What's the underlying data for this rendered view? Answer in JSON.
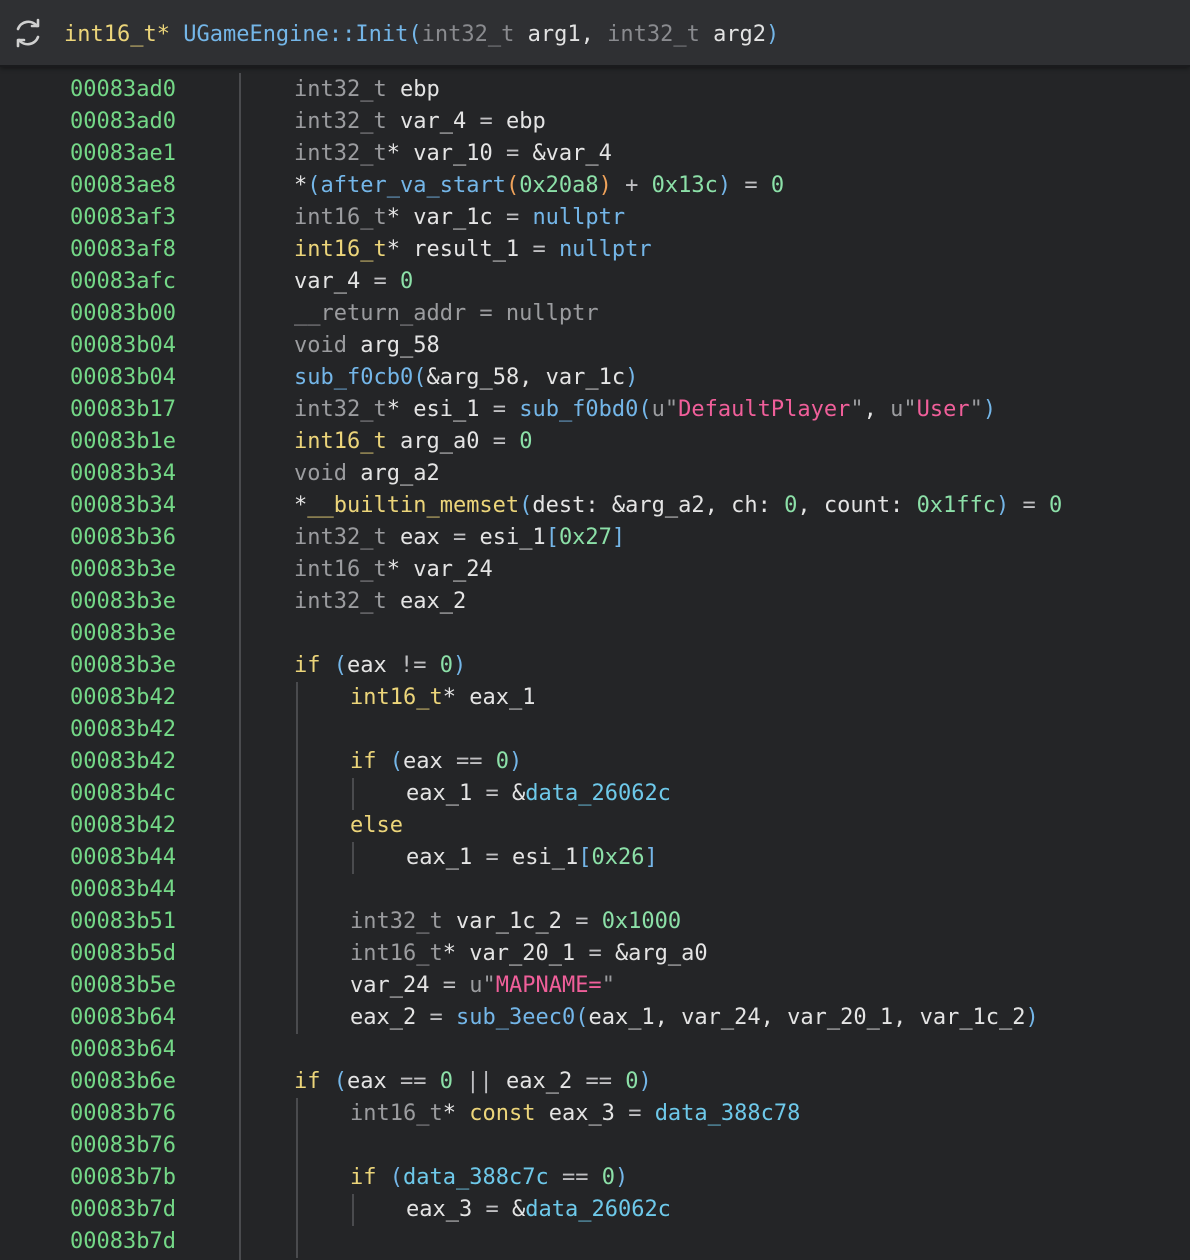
{
  "header": {
    "return_type": "int16_t*",
    "function_name": "UGameEngine::Init",
    "open_paren": "(",
    "param1_type": "int32_t",
    "param1_name": "arg1",
    "comma": ",",
    "param2_type": "int32_t",
    "param2_name": "arg2",
    "close_paren": ")"
  },
  "lines": [
    {
      "addr": "00083ad0",
      "tokens": [
        [
          "int32_t ",
          "type"
        ],
        [
          "ebp",
          "var"
        ]
      ]
    },
    {
      "addr": "00083ad0",
      "tokens": [
        [
          "int32_t ",
          "type"
        ],
        [
          "var_4 ",
          "var"
        ],
        [
          "= ",
          "op"
        ],
        [
          "ebp",
          "var"
        ]
      ]
    },
    {
      "addr": "00083ae1",
      "tokens": [
        [
          "int32_t",
          "type"
        ],
        [
          "* ",
          "var"
        ],
        [
          "var_10 ",
          "var"
        ],
        [
          "= ",
          "op"
        ],
        [
          "&var_4",
          "var"
        ]
      ]
    },
    {
      "addr": "00083ae8",
      "tokens": [
        [
          "*",
          "var"
        ],
        [
          "(",
          "paren"
        ],
        [
          "after_va_start",
          "fn"
        ],
        [
          "(",
          "orange"
        ],
        [
          "0x20a8",
          "hex"
        ],
        [
          ")",
          "orange"
        ],
        [
          " + ",
          "op"
        ],
        [
          "0x13c",
          "hex"
        ],
        [
          ")",
          "paren"
        ],
        [
          " = ",
          "op"
        ],
        [
          "0",
          "num"
        ]
      ]
    },
    {
      "addr": "00083af3",
      "tokens": [
        [
          "int16_t",
          "type"
        ],
        [
          "* ",
          "var"
        ],
        [
          "var_1c ",
          "var"
        ],
        [
          "= ",
          "op"
        ],
        [
          "nullptr",
          "fn"
        ]
      ]
    },
    {
      "addr": "00083af8",
      "tokens": [
        [
          "int16_t",
          "type-hi"
        ],
        [
          "* ",
          "var"
        ],
        [
          "result_1 ",
          "var"
        ],
        [
          "= ",
          "op"
        ],
        [
          "nullptr",
          "fn"
        ]
      ]
    },
    {
      "addr": "00083afc",
      "tokens": [
        [
          "var_4 ",
          "var"
        ],
        [
          "= ",
          "op"
        ],
        [
          "0",
          "num"
        ]
      ]
    },
    {
      "addr": "00083b00",
      "tokens": [
        [
          "__return_addr = nullptr",
          "dim"
        ]
      ]
    },
    {
      "addr": "00083b04",
      "tokens": [
        [
          "void ",
          "type"
        ],
        [
          "arg_58",
          "var"
        ]
      ]
    },
    {
      "addr": "00083b04",
      "tokens": [
        [
          "sub_f0cb0",
          "fn"
        ],
        [
          "(",
          "paren"
        ],
        [
          "&arg_58, var_1c",
          "var"
        ],
        [
          ")",
          "paren"
        ]
      ]
    },
    {
      "addr": "00083b17",
      "tokens": [
        [
          "int32_t",
          "type"
        ],
        [
          "* ",
          "var"
        ],
        [
          "esi_1 ",
          "var"
        ],
        [
          "= ",
          "op"
        ],
        [
          "sub_f0bd0",
          "fn"
        ],
        [
          "(",
          "paren"
        ],
        [
          "u\"",
          "dim"
        ],
        [
          "DefaultPlayer",
          "str"
        ],
        [
          "\"",
          "dim"
        ],
        [
          ", ",
          "var"
        ],
        [
          "u\"",
          "dim"
        ],
        [
          "User",
          "str"
        ],
        [
          "\"",
          "dim"
        ],
        [
          ")",
          "paren"
        ]
      ]
    },
    {
      "addr": "00083b1e",
      "tokens": [
        [
          "int16_t ",
          "type-hi"
        ],
        [
          "arg_a0 ",
          "var"
        ],
        [
          "= ",
          "op"
        ],
        [
          "0",
          "num"
        ]
      ]
    },
    {
      "addr": "00083b34",
      "tokens": [
        [
          "void ",
          "type"
        ],
        [
          "arg_a2",
          "var"
        ]
      ]
    },
    {
      "addr": "00083b34",
      "tokens": [
        [
          "*",
          "var"
        ],
        [
          "__builtin_memset",
          "kw"
        ],
        [
          "(",
          "paren"
        ],
        [
          "dest: &arg_a2, ch: ",
          "var"
        ],
        [
          "0",
          "num"
        ],
        [
          ", count: ",
          "var"
        ],
        [
          "0x1ffc",
          "hex"
        ],
        [
          ")",
          "paren"
        ],
        [
          " = ",
          "op"
        ],
        [
          "0",
          "num"
        ]
      ]
    },
    {
      "addr": "00083b36",
      "tokens": [
        [
          "int32_t ",
          "type"
        ],
        [
          "eax ",
          "var"
        ],
        [
          "= ",
          "op"
        ],
        [
          "esi_1",
          "var"
        ],
        [
          "[",
          "brk"
        ],
        [
          "0x27",
          "hex"
        ],
        [
          "]",
          "brk"
        ]
      ]
    },
    {
      "addr": "00083b3e",
      "tokens": [
        [
          "int16_t",
          "type"
        ],
        [
          "* ",
          "var"
        ],
        [
          "var_24",
          "var"
        ]
      ]
    },
    {
      "addr": "00083b3e",
      "tokens": [
        [
          "int32_t ",
          "type"
        ],
        [
          "eax_2",
          "var"
        ]
      ]
    },
    {
      "addr": "00083b3e",
      "tokens": []
    },
    {
      "addr": "00083b3e",
      "tokens": [
        [
          "if ",
          "kw"
        ],
        [
          "(",
          "paren"
        ],
        [
          "eax ",
          "var"
        ],
        [
          "!= ",
          "op"
        ],
        [
          "0",
          "num"
        ],
        [
          ")",
          "paren"
        ]
      ]
    },
    {
      "addr": "00083b42",
      "indent": 1,
      "tokens": [
        [
          "int16_t",
          "type-hi"
        ],
        [
          "* ",
          "var"
        ],
        [
          "eax_1",
          "var"
        ]
      ]
    },
    {
      "addr": "00083b42",
      "indent": 1,
      "tokens": []
    },
    {
      "addr": "00083b42",
      "indent": 1,
      "tokens": [
        [
          "if ",
          "kw"
        ],
        [
          "(",
          "paren"
        ],
        [
          "eax ",
          "var"
        ],
        [
          "== ",
          "op"
        ],
        [
          "0",
          "num"
        ],
        [
          ")",
          "paren"
        ]
      ]
    },
    {
      "addr": "00083b4c",
      "indent": 2,
      "tokens": [
        [
          "eax_1 ",
          "var"
        ],
        [
          "= ",
          "op"
        ],
        [
          "&",
          "var"
        ],
        [
          "data_26062c",
          "data"
        ]
      ]
    },
    {
      "addr": "00083b42",
      "indent": 1,
      "tokens": [
        [
          "else",
          "kw"
        ]
      ]
    },
    {
      "addr": "00083b44",
      "indent": 2,
      "tokens": [
        [
          "eax_1 ",
          "var"
        ],
        [
          "= ",
          "op"
        ],
        [
          "esi_1",
          "var"
        ],
        [
          "[",
          "brk"
        ],
        [
          "0x26",
          "hex"
        ],
        [
          "]",
          "brk"
        ]
      ]
    },
    {
      "addr": "00083b44",
      "indent": 1,
      "tokens": []
    },
    {
      "addr": "00083b51",
      "indent": 1,
      "tokens": [
        [
          "int32_t ",
          "type"
        ],
        [
          "var_1c_2 ",
          "var"
        ],
        [
          "= ",
          "op"
        ],
        [
          "0x1000",
          "hex"
        ]
      ]
    },
    {
      "addr": "00083b5d",
      "indent": 1,
      "tokens": [
        [
          "int16_t",
          "type"
        ],
        [
          "* ",
          "var"
        ],
        [
          "var_20_1 ",
          "var"
        ],
        [
          "= ",
          "op"
        ],
        [
          "&arg_a0",
          "var"
        ]
      ]
    },
    {
      "addr": "00083b5e",
      "indent": 1,
      "tokens": [
        [
          "var_24 ",
          "var"
        ],
        [
          "= ",
          "op"
        ],
        [
          "u\"",
          "dim"
        ],
        [
          "MAPNAME=",
          "str"
        ],
        [
          "\"",
          "dim"
        ]
      ]
    },
    {
      "addr": "00083b64",
      "indent": 1,
      "tokens": [
        [
          "eax_2 ",
          "var"
        ],
        [
          "= ",
          "op"
        ],
        [
          "sub_3eec0",
          "fn"
        ],
        [
          "(",
          "paren"
        ],
        [
          "eax_1, var_24, var_20_1, var_1c_2",
          "var"
        ],
        [
          ")",
          "paren"
        ]
      ]
    },
    {
      "addr": "00083b64",
      "tokens": []
    },
    {
      "addr": "00083b6e",
      "tokens": [
        [
          "if ",
          "kw"
        ],
        [
          "(",
          "paren"
        ],
        [
          "eax ",
          "var"
        ],
        [
          "== ",
          "op"
        ],
        [
          "0",
          "num"
        ],
        [
          " || ",
          "op"
        ],
        [
          "eax_2 ",
          "var"
        ],
        [
          "== ",
          "op"
        ],
        [
          "0",
          "num"
        ],
        [
          ")",
          "paren"
        ]
      ]
    },
    {
      "addr": "00083b76",
      "indent": 1,
      "tokens": [
        [
          "int16_t",
          "type"
        ],
        [
          "* ",
          "var"
        ],
        [
          "const ",
          "const"
        ],
        [
          "eax_3 ",
          "var"
        ],
        [
          "= ",
          "op"
        ],
        [
          "data_388c78",
          "data"
        ]
      ]
    },
    {
      "addr": "00083b76",
      "indent": 1,
      "tokens": []
    },
    {
      "addr": "00083b7b",
      "indent": 1,
      "tokens": [
        [
          "if ",
          "kw"
        ],
        [
          "(",
          "paren"
        ],
        [
          "data_388c7c ",
          "data"
        ],
        [
          "== ",
          "op"
        ],
        [
          "0",
          "num"
        ],
        [
          ")",
          "paren"
        ]
      ]
    },
    {
      "addr": "00083b7d",
      "indent": 2,
      "tokens": [
        [
          "eax_3 ",
          "var"
        ],
        [
          "= ",
          "op"
        ],
        [
          "&",
          "var"
        ],
        [
          "data_26062c",
          "data"
        ]
      ]
    },
    {
      "addr": "00083b7d",
      "indent": 1,
      "tokens": []
    }
  ],
  "colors": {
    "background": "#242527",
    "header_background": "#2f3033",
    "address": "#74d887",
    "function": "#74b6e8",
    "keyword": "#ecd57a",
    "string": "#f05f9a",
    "number": "#8ce0a8"
  }
}
